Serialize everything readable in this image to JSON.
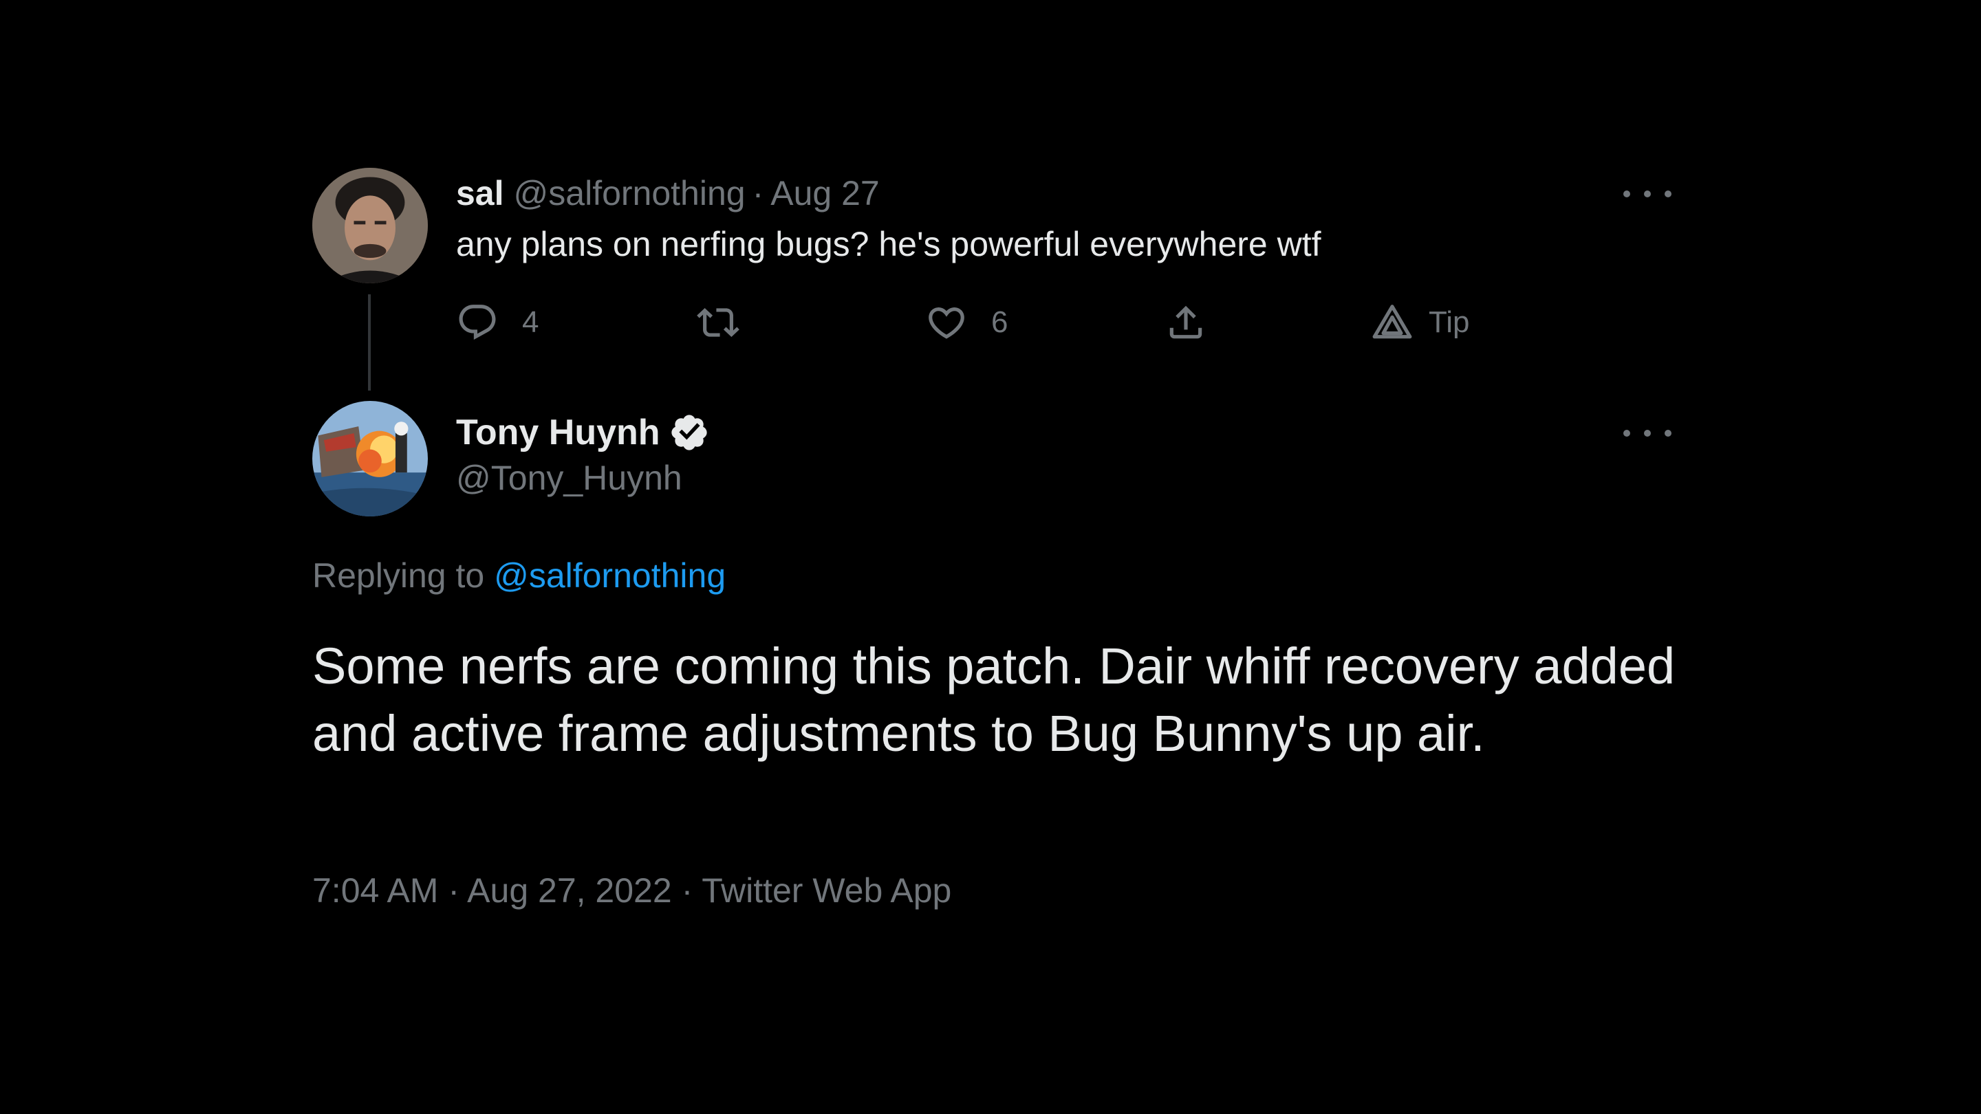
{
  "parent_tweet": {
    "display_name": "sal",
    "handle": "@salfornothing",
    "separator": "·",
    "date": "Aug 27",
    "text": "any plans on nerfing bugs? he's powerful everywhere wtf",
    "actions": {
      "reply_count": "4",
      "retweet_count": "",
      "like_count": "6",
      "tip_label": "Tip"
    },
    "icons": [
      "reply-icon",
      "retweet-icon",
      "like-icon",
      "share-icon",
      "tip-icon",
      "more-icon"
    ]
  },
  "reply_tweet": {
    "display_name": "Tony Huynh",
    "handle": "@Tony_Huynh",
    "verified": true,
    "replying_prefix": "Replying to",
    "replying_to": "@salfornothing",
    "text": "Some nerfs are coming this patch. Dair whiff recovery added and active frame adjustments to Bug Bunny's up air.",
    "time": "7:04 AM",
    "separator": "·",
    "date": "Aug 27, 2022",
    "source": "Twitter Web App"
  },
  "colors": {
    "background": "#000000",
    "primary_text": "#e7e9ea",
    "secondary_text": "#71767b",
    "link": "#1d9bf0",
    "thread_line": "#333639"
  }
}
